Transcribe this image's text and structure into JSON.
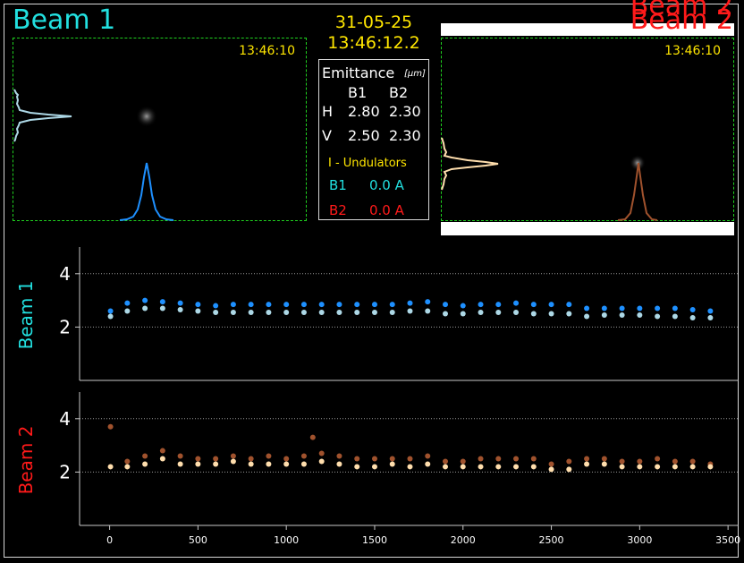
{
  "header": {
    "date": "31-05-25",
    "time": "13:46:12.2",
    "beam1_title": "Beam 1",
    "beam2_title": "Beam 2",
    "beam2_title_ghost": "Beam 2"
  },
  "cameras": {
    "beam1_timestamp": "13:46:10",
    "beam2_timestamp": "13:46:10"
  },
  "emittance": {
    "title": "Emittance",
    "unit": "[μm]",
    "col_b1": "B1",
    "col_b2": "B2",
    "row_h_label": "H",
    "row_h_b1": "2.80",
    "row_h_b2": "2.30",
    "row_v_label": "V",
    "row_v_b1": "2.50",
    "row_v_b2": "2.30"
  },
  "undulators": {
    "title": "I - Undulators",
    "b1_label": "B1",
    "b1_value": "0.0 A",
    "b2_label": "B2",
    "b2_value": "0.0 A"
  },
  "colors": {
    "beam1": "#22e0e0",
    "beam2": "#ff1a1a",
    "b1_high": "#1e90ff",
    "b1_low": "#add8e6",
    "b2_high": "#a0522d",
    "b2_low": "#ffdead",
    "timestamp": "#ffe600",
    "roi": "#1fd11f"
  },
  "chart_data": [
    {
      "type": "scatter",
      "title": "",
      "ylabel": "Beam 1",
      "xlim": [
        -170,
        3560
      ],
      "ylim": [
        0,
        5
      ],
      "yticks": [
        2,
        4
      ],
      "grid": "horizontal dotted at 2 and 4",
      "series": [
        {
          "color": "#1e90ff",
          "points": [
            [
              5,
              2.6
            ],
            [
              100,
              2.9
            ],
            [
              200,
              3.0
            ],
            [
              300,
              2.95
            ],
            [
              400,
              2.9
            ],
            [
              500,
              2.85
            ],
            [
              600,
              2.8
            ],
            [
              700,
              2.85
            ],
            [
              800,
              2.85
            ],
            [
              900,
              2.85
            ],
            [
              1000,
              2.85
            ],
            [
              1100,
              2.85
            ],
            [
              1200,
              2.85
            ],
            [
              1300,
              2.85
            ],
            [
              1400,
              2.85
            ],
            [
              1500,
              2.85
            ],
            [
              1600,
              2.85
            ],
            [
              1700,
              2.9
            ],
            [
              1800,
              2.95
            ],
            [
              1900,
              2.85
            ],
            [
              2000,
              2.8
            ],
            [
              2100,
              2.85
            ],
            [
              2200,
              2.85
            ],
            [
              2300,
              2.9
            ],
            [
              2400,
              2.85
            ],
            [
              2500,
              2.85
            ],
            [
              2600,
              2.85
            ],
            [
              2700,
              2.7
            ],
            [
              2800,
              2.7
            ],
            [
              2900,
              2.7
            ],
            [
              3000,
              2.7
            ],
            [
              3100,
              2.7
            ],
            [
              3200,
              2.7
            ],
            [
              3300,
              2.65
            ],
            [
              3400,
              2.6
            ]
          ]
        },
        {
          "color": "#add8e6",
          "points": [
            [
              5,
              2.4
            ],
            [
              100,
              2.6
            ],
            [
              200,
              2.7
            ],
            [
              300,
              2.7
            ],
            [
              400,
              2.65
            ],
            [
              500,
              2.6
            ],
            [
              600,
              2.55
            ],
            [
              700,
              2.55
            ],
            [
              800,
              2.55
            ],
            [
              900,
              2.55
            ],
            [
              1000,
              2.55
            ],
            [
              1100,
              2.55
            ],
            [
              1200,
              2.55
            ],
            [
              1300,
              2.55
            ],
            [
              1400,
              2.55
            ],
            [
              1500,
              2.55
            ],
            [
              1600,
              2.55
            ],
            [
              1700,
              2.6
            ],
            [
              1800,
              2.6
            ],
            [
              1900,
              2.5
            ],
            [
              2000,
              2.5
            ],
            [
              2100,
              2.55
            ],
            [
              2200,
              2.55
            ],
            [
              2300,
              2.55
            ],
            [
              2400,
              2.5
            ],
            [
              2500,
              2.5
            ],
            [
              2600,
              2.5
            ],
            [
              2700,
              2.4
            ],
            [
              2800,
              2.45
            ],
            [
              2900,
              2.45
            ],
            [
              3000,
              2.45
            ],
            [
              3100,
              2.4
            ],
            [
              3200,
              2.4
            ],
            [
              3300,
              2.35
            ],
            [
              3400,
              2.35
            ]
          ]
        }
      ]
    },
    {
      "type": "scatter",
      "title": "",
      "ylabel": "Beam 2",
      "xlim": [
        -170,
        3560
      ],
      "ylim": [
        0,
        5
      ],
      "xticks": [
        0,
        500,
        1000,
        1500,
        2000,
        2500,
        3000,
        3500
      ],
      "yticks": [
        2,
        4
      ],
      "grid": "horizontal dotted at 2 and 4",
      "series": [
        {
          "color": "#a0522d",
          "points": [
            [
              5,
              3.7
            ],
            [
              100,
              2.4
            ],
            [
              200,
              2.6
            ],
            [
              300,
              2.8
            ],
            [
              400,
              2.6
            ],
            [
              500,
              2.5
            ],
            [
              600,
              2.5
            ],
            [
              700,
              2.6
            ],
            [
              800,
              2.5
            ],
            [
              900,
              2.6
            ],
            [
              1000,
              2.5
            ],
            [
              1100,
              2.6
            ],
            [
              1150,
              3.3
            ],
            [
              1200,
              2.7
            ],
            [
              1300,
              2.6
            ],
            [
              1400,
              2.5
            ],
            [
              1500,
              2.5
            ],
            [
              1600,
              2.5
            ],
            [
              1700,
              2.5
            ],
            [
              1800,
              2.6
            ],
            [
              1900,
              2.4
            ],
            [
              2000,
              2.4
            ],
            [
              2100,
              2.5
            ],
            [
              2200,
              2.5
            ],
            [
              2300,
              2.5
            ],
            [
              2400,
              2.5
            ],
            [
              2500,
              2.3
            ],
            [
              2600,
              2.4
            ],
            [
              2700,
              2.5
            ],
            [
              2800,
              2.5
            ],
            [
              2900,
              2.4
            ],
            [
              3000,
              2.4
            ],
            [
              3100,
              2.5
            ],
            [
              3200,
              2.4
            ],
            [
              3300,
              2.4
            ],
            [
              3400,
              2.3
            ]
          ]
        },
        {
          "color": "#ffdead",
          "points": [
            [
              5,
              2.2
            ],
            [
              100,
              2.2
            ],
            [
              200,
              2.3
            ],
            [
              300,
              2.5
            ],
            [
              400,
              2.3
            ],
            [
              500,
              2.3
            ],
            [
              600,
              2.3
            ],
            [
              700,
              2.4
            ],
            [
              800,
              2.3
            ],
            [
              900,
              2.3
            ],
            [
              1000,
              2.3
            ],
            [
              1100,
              2.3
            ],
            [
              1200,
              2.4
            ],
            [
              1300,
              2.3
            ],
            [
              1400,
              2.2
            ],
            [
              1500,
              2.2
            ],
            [
              1600,
              2.3
            ],
            [
              1700,
              2.2
            ],
            [
              1800,
              2.3
            ],
            [
              1900,
              2.2
            ],
            [
              2000,
              2.2
            ],
            [
              2100,
              2.2
            ],
            [
              2200,
              2.2
            ],
            [
              2300,
              2.2
            ],
            [
              2400,
              2.2
            ],
            [
              2500,
              2.1
            ],
            [
              2600,
              2.1
            ],
            [
              2700,
              2.3
            ],
            [
              2800,
              2.3
            ],
            [
              2900,
              2.2
            ],
            [
              3000,
              2.2
            ],
            [
              3100,
              2.2
            ],
            [
              3200,
              2.2
            ],
            [
              3300,
              2.2
            ],
            [
              3400,
              2.2
            ]
          ]
        }
      ]
    }
  ]
}
